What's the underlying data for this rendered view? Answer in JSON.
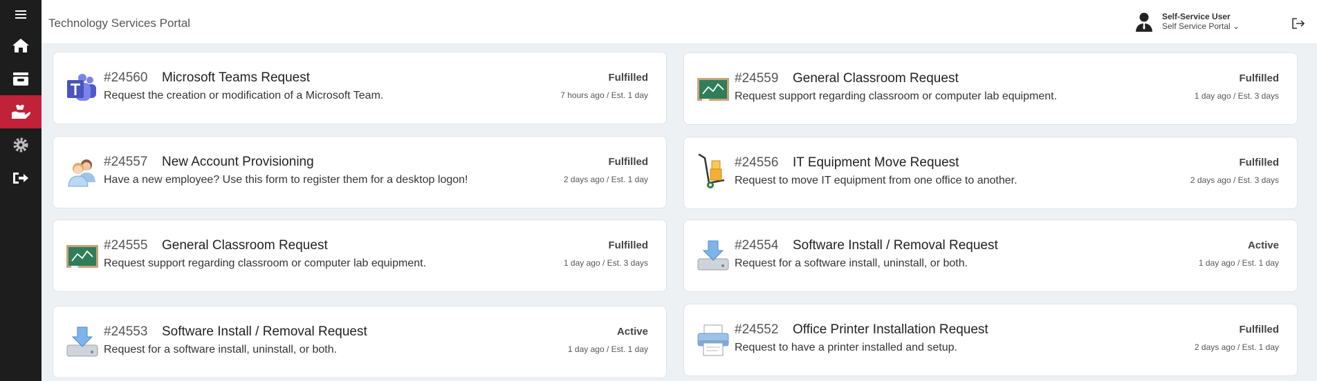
{
  "header": {
    "title": "Technology Services Portal",
    "user_name": "Self-Service User",
    "user_portal": "Self Service Portal ⌄"
  },
  "sidebar": {
    "items": [
      {
        "icon": "menu-icon"
      },
      {
        "icon": "home-icon"
      },
      {
        "icon": "inbox-icon"
      },
      {
        "icon": "requests-icon",
        "active": true
      },
      {
        "icon": "gear-icon"
      },
      {
        "icon": "sign-out-icon"
      }
    ]
  },
  "accent_color": "#c2213a",
  "requests": [
    {
      "number": "#24560",
      "title": "Microsoft Teams Request",
      "description": "Request the creation or modification of a Microsoft Team.",
      "status": "Fulfilled",
      "time": "7 hours ago / Est. 1 day",
      "icon": "teams-icon"
    },
    {
      "number": "#24559",
      "title": "General Classroom Request",
      "description": "Request support regarding classroom or computer lab equipment.",
      "status": "Fulfilled",
      "time": "1 day ago / Est. 3 days",
      "icon": "chalkboard-icon"
    },
    {
      "number": "#24557",
      "title": "New Account Provisioning",
      "description": "Have a new employee? Use this form to register them for a desktop logon!",
      "status": "Fulfilled",
      "time": "2 days ago / Est. 1 day",
      "icon": "users-icon"
    },
    {
      "number": "#24556",
      "title": "IT Equipment Move Request",
      "description": "Request to move IT equipment from one office to another.",
      "status": "Fulfilled",
      "time": "2 days ago / Est. 3 days",
      "icon": "hand-truck-icon"
    },
    {
      "number": "#24555",
      "title": "General Classroom Request",
      "description": "Request support regarding classroom or computer lab equipment.",
      "status": "Fulfilled",
      "time": "1 day ago / Est. 3 days",
      "icon": "chalkboard-icon"
    },
    {
      "number": "#24554",
      "title": "Software Install / Removal Request",
      "description": "Request for a software install, uninstall, or both.",
      "status": "Active",
      "time": "1 day ago / Est. 1 day",
      "icon": "download-drive-icon"
    },
    {
      "number": "#24553",
      "title": "Software Install / Removal Request",
      "description": "Request for a software install, uninstall, or both.",
      "status": "Active",
      "time": "1 day ago / Est. 1 day",
      "icon": "download-drive-icon"
    },
    {
      "number": "#24552",
      "title": "Office Printer Installation Request",
      "description": "Request to have a printer installed and setup.",
      "status": "Fulfilled",
      "time": "2 days ago / Est. 1 day",
      "icon": "printer-icon"
    }
  ]
}
